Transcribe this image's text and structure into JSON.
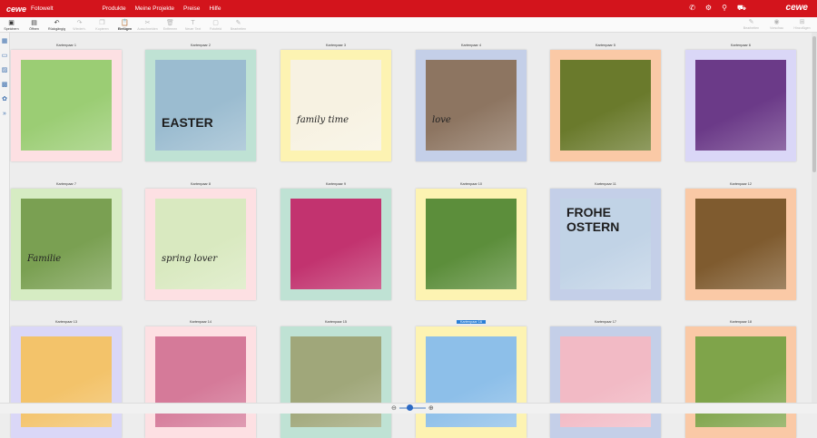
{
  "app": {
    "brand": "cewe",
    "name": "Fotowelt",
    "brand_right": "cewe"
  },
  "menu": [
    "Produkte",
    "Meine Projekte",
    "Preise",
    "Hilfe"
  ],
  "top_icons": [
    "phone-icon",
    "gear-icon",
    "user-icon",
    "cart-icon"
  ],
  "toolbar": {
    "items": [
      {
        "label": "Speichern",
        "icon": "save-icon",
        "enabled": true
      },
      {
        "label": "Öffnen",
        "icon": "folder-icon",
        "enabled": true
      },
      {
        "label": "Rückgängig",
        "icon": "undo-icon",
        "enabled": true
      },
      {
        "label": "Wiederh.",
        "icon": "redo-icon",
        "enabled": false
      },
      {
        "label": "Kopieren",
        "icon": "copy-icon",
        "enabled": false
      },
      {
        "label": "Einfügen",
        "icon": "paste-icon",
        "enabled": true,
        "bold": true
      },
      {
        "label": "Ausschneiden",
        "icon": "cut-icon",
        "enabled": false
      },
      {
        "label": "Entfernen",
        "icon": "delete-icon",
        "enabled": false
      },
      {
        "label": "Neuer Text",
        "icon": "text-icon",
        "enabled": false
      },
      {
        "label": "Fotofeld",
        "icon": "photo-icon",
        "enabled": false
      },
      {
        "label": "Bearbeiten",
        "icon": "edit-icon",
        "enabled": false
      }
    ],
    "right_items": [
      {
        "label": "Bearbeiten",
        "icon": "edit-icon"
      },
      {
        "label": "Vorschau",
        "icon": "preview-icon"
      },
      {
        "label": "Hinzufügen",
        "icon": "add-icon"
      }
    ]
  },
  "sidebar_icons": [
    "layout-icon",
    "pages-icon",
    "photos-icon",
    "backgrounds-icon",
    "clipart-icon",
    "expand-icon"
  ],
  "cards": [
    {
      "label": "Kartenpaar 1",
      "bg": "#fde0e3",
      "photo": "#9bcd74",
      "caption": "",
      "selected": false
    },
    {
      "label": "Kartenpaar 2",
      "bg": "#bfe2d4",
      "photo": "#9bbcd0",
      "caption": "EASTER",
      "selected": false
    },
    {
      "label": "Kartenpaar 3",
      "bg": "#fdf3b2",
      "photo": "#f7f2e2",
      "caption": "family time",
      "selected": false
    },
    {
      "label": "Kartenpaar 4",
      "bg": "#c4cfe8",
      "photo": "#8d7561",
      "caption": "love",
      "selected": false
    },
    {
      "label": "Kartenpaar 5",
      "bg": "#fac9a6",
      "photo": "#6a7a2c",
      "caption": "",
      "selected": false
    },
    {
      "label": "Kartenpaar 6",
      "bg": "#dad7f7",
      "photo": "#6b3a88",
      "caption": "",
      "selected": false
    },
    {
      "label": "Kartenpaar 7",
      "bg": "#d6ecc3",
      "photo": "#7aa052",
      "caption": "Familie",
      "selected": false
    },
    {
      "label": "Kartenpaar 8",
      "bg": "#fde0e3",
      "photo": "#d9e9c0",
      "caption": "spring lover",
      "selected": false
    },
    {
      "label": "Kartenpaar 9",
      "bg": "#bfe2d4",
      "photo": "#c2336f",
      "caption": "",
      "selected": false
    },
    {
      "label": "Kartenpaar 10",
      "bg": "#fdf3b2",
      "photo": "#5c8e3b",
      "caption": "",
      "selected": false
    },
    {
      "label": "Kartenpaar 11",
      "bg": "#c4cfe8",
      "photo": "#c1d3e6",
      "caption": "FROHE OSTERN",
      "selected": false
    },
    {
      "label": "Kartenpaar 12",
      "bg": "#fac9a6",
      "photo": "#7f5b2f",
      "caption": "",
      "selected": false
    },
    {
      "label": "Kartenpaar 13",
      "bg": "#dad7f7",
      "photo": "#f3c36a",
      "caption": "",
      "selected": false
    },
    {
      "label": "Kartenpaar 14",
      "bg": "#fde0e3",
      "photo": "#d57a99",
      "caption": "",
      "selected": false
    },
    {
      "label": "Kartenpaar 15",
      "bg": "#bfe2d4",
      "photo": "#a0a77a",
      "caption": "",
      "selected": false
    },
    {
      "label": "Kartenpaar 16",
      "bg": "#fdf3b2",
      "photo": "#8dbfe9",
      "caption": "",
      "selected": true
    },
    {
      "label": "Kartenpaar 17",
      "bg": "#c4cfe8",
      "photo": "#f2bac5",
      "caption": "",
      "selected": false
    },
    {
      "label": "Kartenpaar 18",
      "bg": "#fac9a6",
      "photo": "#7fa44a",
      "caption": "",
      "selected": false
    }
  ],
  "colors": {
    "accent": "#d3141c",
    "selection": "#2a7fd8"
  },
  "zoom": {
    "minus_icon": "zoom-out-icon",
    "plus_icon": "zoom-in-icon",
    "level": 0.35
  }
}
